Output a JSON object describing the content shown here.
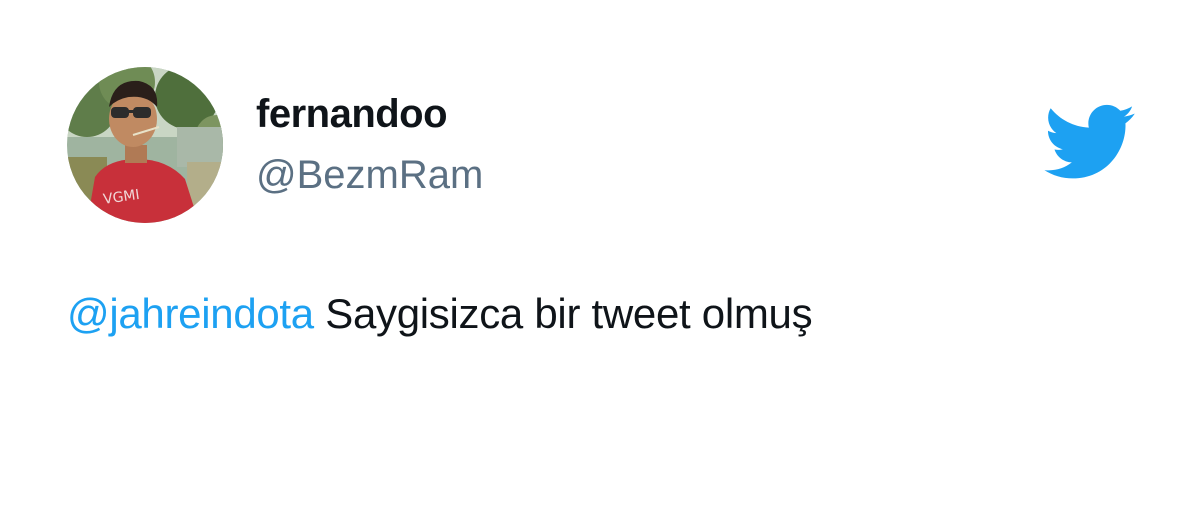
{
  "user": {
    "display_name": "fernandoo",
    "handle": "@BezmRam",
    "avatar_icon": "profile-photo"
  },
  "tweet": {
    "mention": "@jahreindota",
    "body": " Saygisizca bir tweet olmuş"
  },
  "brand": {
    "logo_icon": "twitter-bird-icon",
    "accent_color": "#1da1f2"
  }
}
